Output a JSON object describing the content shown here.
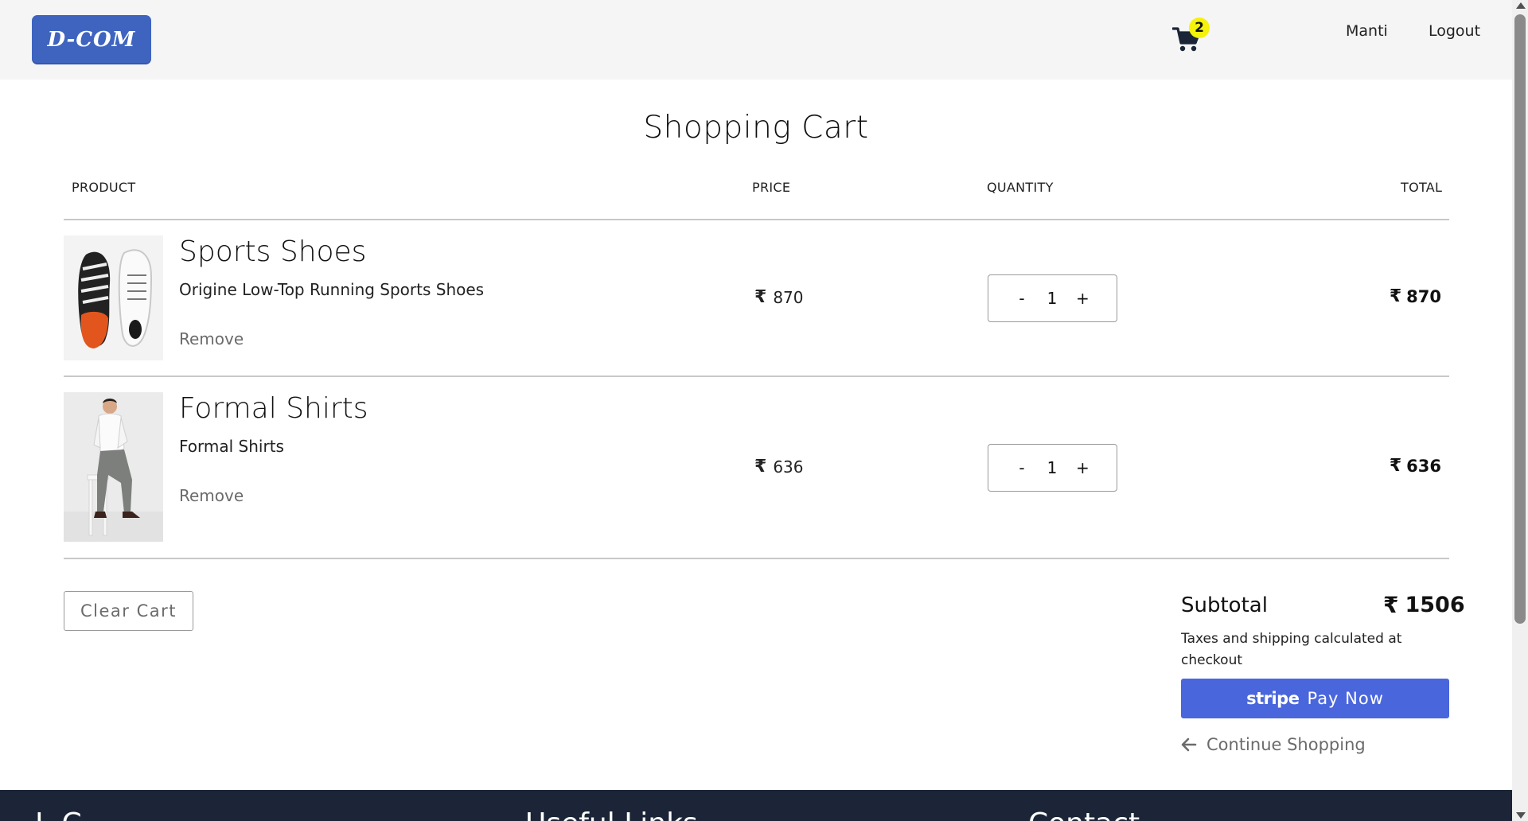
{
  "header": {
    "logo_text": "D-COM",
    "cart_count": "2",
    "user_name": "Manti",
    "logout_label": "Logout"
  },
  "page_title": "Shopping Cart",
  "columns": {
    "product": "PRODUCT",
    "price": "PRICE",
    "quantity": "QUANTITY",
    "total": "TOTAL"
  },
  "currency_symbol": "₹",
  "items": [
    {
      "name": "Sports Shoes",
      "description": "Origine Low-Top Running Sports Shoes",
      "remove_label": "Remove",
      "price": "870",
      "quantity": "1",
      "total": "870",
      "decrement": "-",
      "increment": "+"
    },
    {
      "name": "Formal Shirts",
      "description": "Formal Shirts",
      "remove_label": "Remove",
      "price": "636",
      "quantity": "1",
      "total": "636",
      "decrement": "-",
      "increment": "+"
    }
  ],
  "summary": {
    "clear_label": "Clear Cart",
    "subtotal_label": "Subtotal",
    "subtotal_amount": "1506",
    "tax_note": "Taxes and shipping calculated at checkout",
    "pay_brand": "stripe",
    "pay_label": "Pay Now",
    "continue_label": "Continue Shopping"
  },
  "footer": {
    "col1_heading": "I. C",
    "col2_heading": "Useful Links",
    "col3_heading": "Contact"
  },
  "colors": {
    "header_bg": "#f5f5f5",
    "logo_bg": "#3e64c0",
    "badge_bg": "#f4f20c",
    "pay_button_bg": "#4a66dc",
    "footer_bg": "#1b2537",
    "cart_icon": "#1b2537"
  },
  "icons": {
    "cart": "shopping-cart-icon",
    "rupee": "rupee-icon",
    "back": "arrow-left-icon"
  }
}
